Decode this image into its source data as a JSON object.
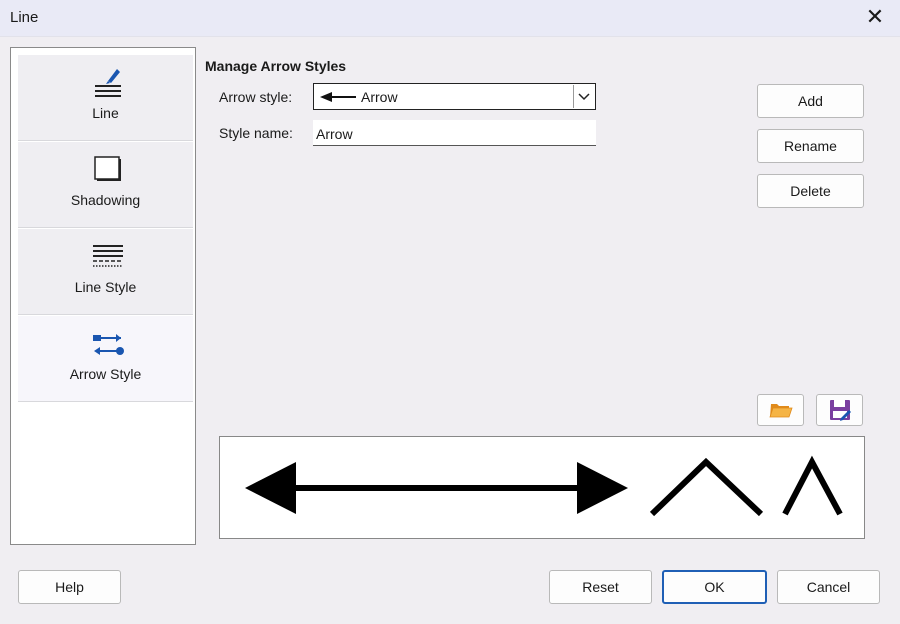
{
  "window": {
    "title": "Line",
    "close_icon": "close-icon"
  },
  "sidebar": {
    "items": [
      {
        "label": "Line",
        "icon": "line-pen-icon",
        "active": false
      },
      {
        "label": "Shadowing",
        "icon": "shadow-square-icon",
        "active": false
      },
      {
        "label": "Line Style",
        "icon": "line-style-icon",
        "active": false
      },
      {
        "label": "Arrow Style",
        "icon": "arrow-style-icon",
        "active": true
      }
    ]
  },
  "main": {
    "heading": "Manage Arrow Styles",
    "arrow_style_label": "Arrow style:",
    "arrow_style_value": "Arrow",
    "style_name_label": "Style name:",
    "style_name_value": "Arrow",
    "buttons": {
      "add": "Add",
      "rename": "Rename",
      "delete": "Delete"
    },
    "load_icon": "open-folder-icon",
    "save_icon": "save-icon"
  },
  "footer": {
    "help": "Help",
    "reset": "Reset",
    "ok": "OK",
    "cancel": "Cancel"
  },
  "colors": {
    "accent": "#1f5fb5",
    "icon_blue": "#1a56b0",
    "folder": "#f0a030",
    "save": "#7a3fa0"
  }
}
